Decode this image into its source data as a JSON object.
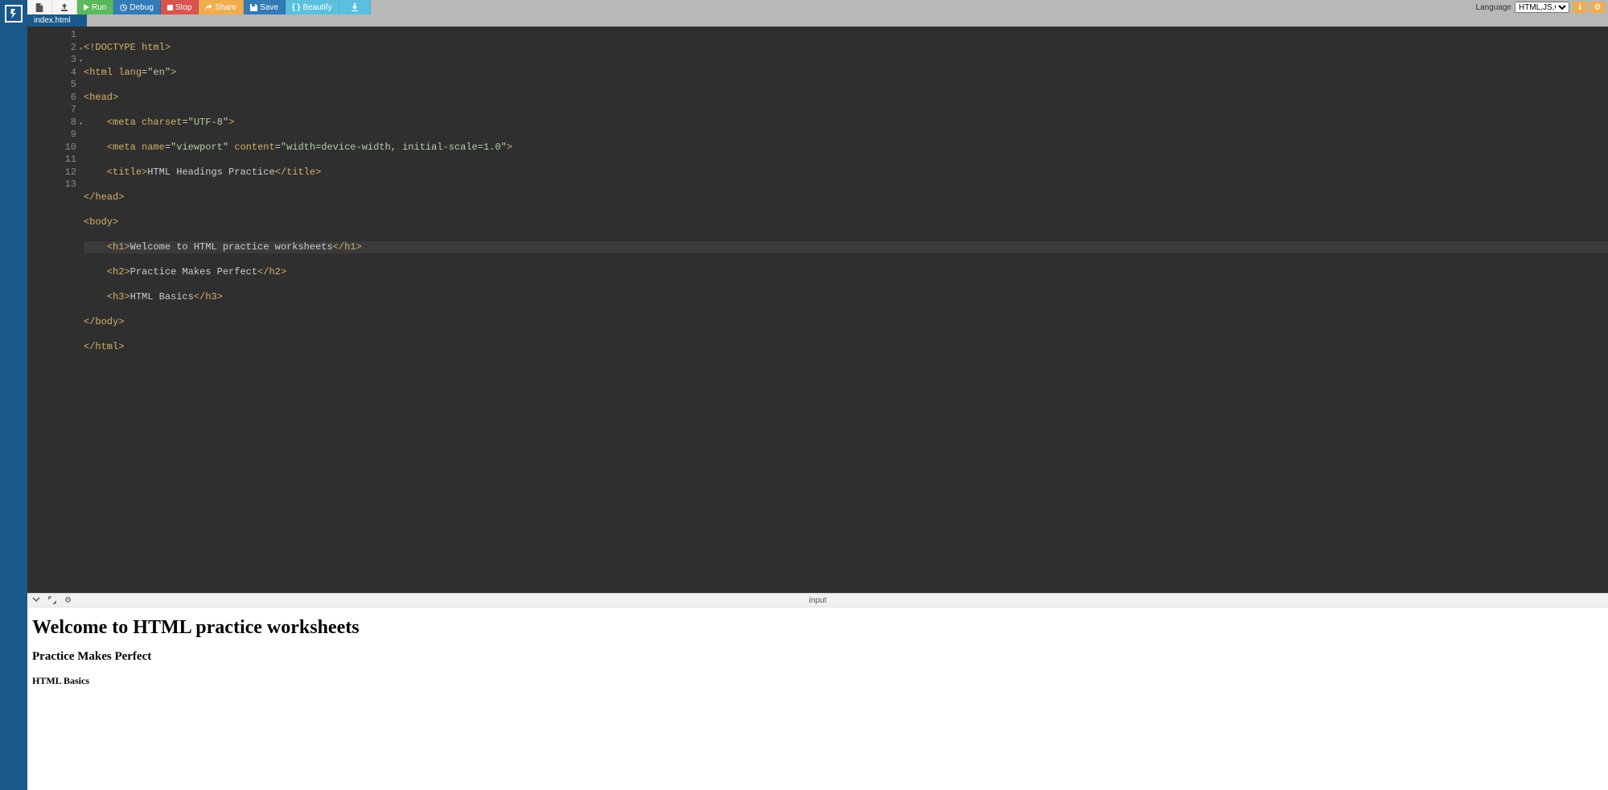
{
  "toolbar": {
    "run": "Run",
    "debug": "Debug",
    "stop": "Stop",
    "share": "Share",
    "save": "Save",
    "beautify": "Beautify",
    "language_label": "Language",
    "language_value": "HTML,JS,CSS"
  },
  "tab": {
    "name": "index.html"
  },
  "editor": {
    "lines": [
      {
        "n": 1,
        "fold": false
      },
      {
        "n": 2,
        "fold": true
      },
      {
        "n": 3,
        "fold": true
      },
      {
        "n": 4,
        "fold": false
      },
      {
        "n": 5,
        "fold": false
      },
      {
        "n": 6,
        "fold": false
      },
      {
        "n": 7,
        "fold": false
      },
      {
        "n": 8,
        "fold": true
      },
      {
        "n": 9,
        "fold": false
      },
      {
        "n": 10,
        "fold": false
      },
      {
        "n": 11,
        "fold": false
      },
      {
        "n": 12,
        "fold": false
      },
      {
        "n": 13,
        "fold": false
      }
    ],
    "code": {
      "l1_doctype": "<!DOCTYPE html>",
      "l2_open": "<html",
      "l2_attr": " lang",
      "l2_eq": "=",
      "l2_val": "\"en\"",
      "l2_close": ">",
      "l3": "<head>",
      "l4_indent": "    ",
      "l4_open": "<meta",
      "l4_attr": " charset",
      "l4_eq": "=",
      "l4_val": "\"UTF-8\"",
      "l4_close": ">",
      "l5_indent": "    ",
      "l5_open": "<meta",
      "l5_a1": " name",
      "l5_eq1": "=",
      "l5_v1": "\"viewport\"",
      "l5_a2": " content",
      "l5_eq2": "=",
      "l5_v2": "\"width=device-width, initial-scale=1.0\"",
      "l5_close": ">",
      "l6_indent": "    ",
      "l6_open": "<title>",
      "l6_text": "HTML Headings Practice",
      "l6_close": "</title>",
      "l7": "</head>",
      "l8": "<body>",
      "l9_indent": "    ",
      "l9_open": "<h1>",
      "l9_text": "Welcome to HTML practice worksheets",
      "l9_close": "</h1>",
      "l10_indent": "    ",
      "l10_open": "<h2>",
      "l10_text": "Practice Makes Perfect",
      "l10_close": "</h2>",
      "l11_indent": "    ",
      "l11_open": "<h3>",
      "l11_text": "HTML Basics",
      "l11_close": "</h3>",
      "l12": "</body>",
      "l13": "</html>"
    }
  },
  "output": {
    "input_label": "input",
    "h1": "Welcome to HTML practice worksheets",
    "h2": "Practice Makes Perfect",
    "h3": "HTML Basics"
  }
}
